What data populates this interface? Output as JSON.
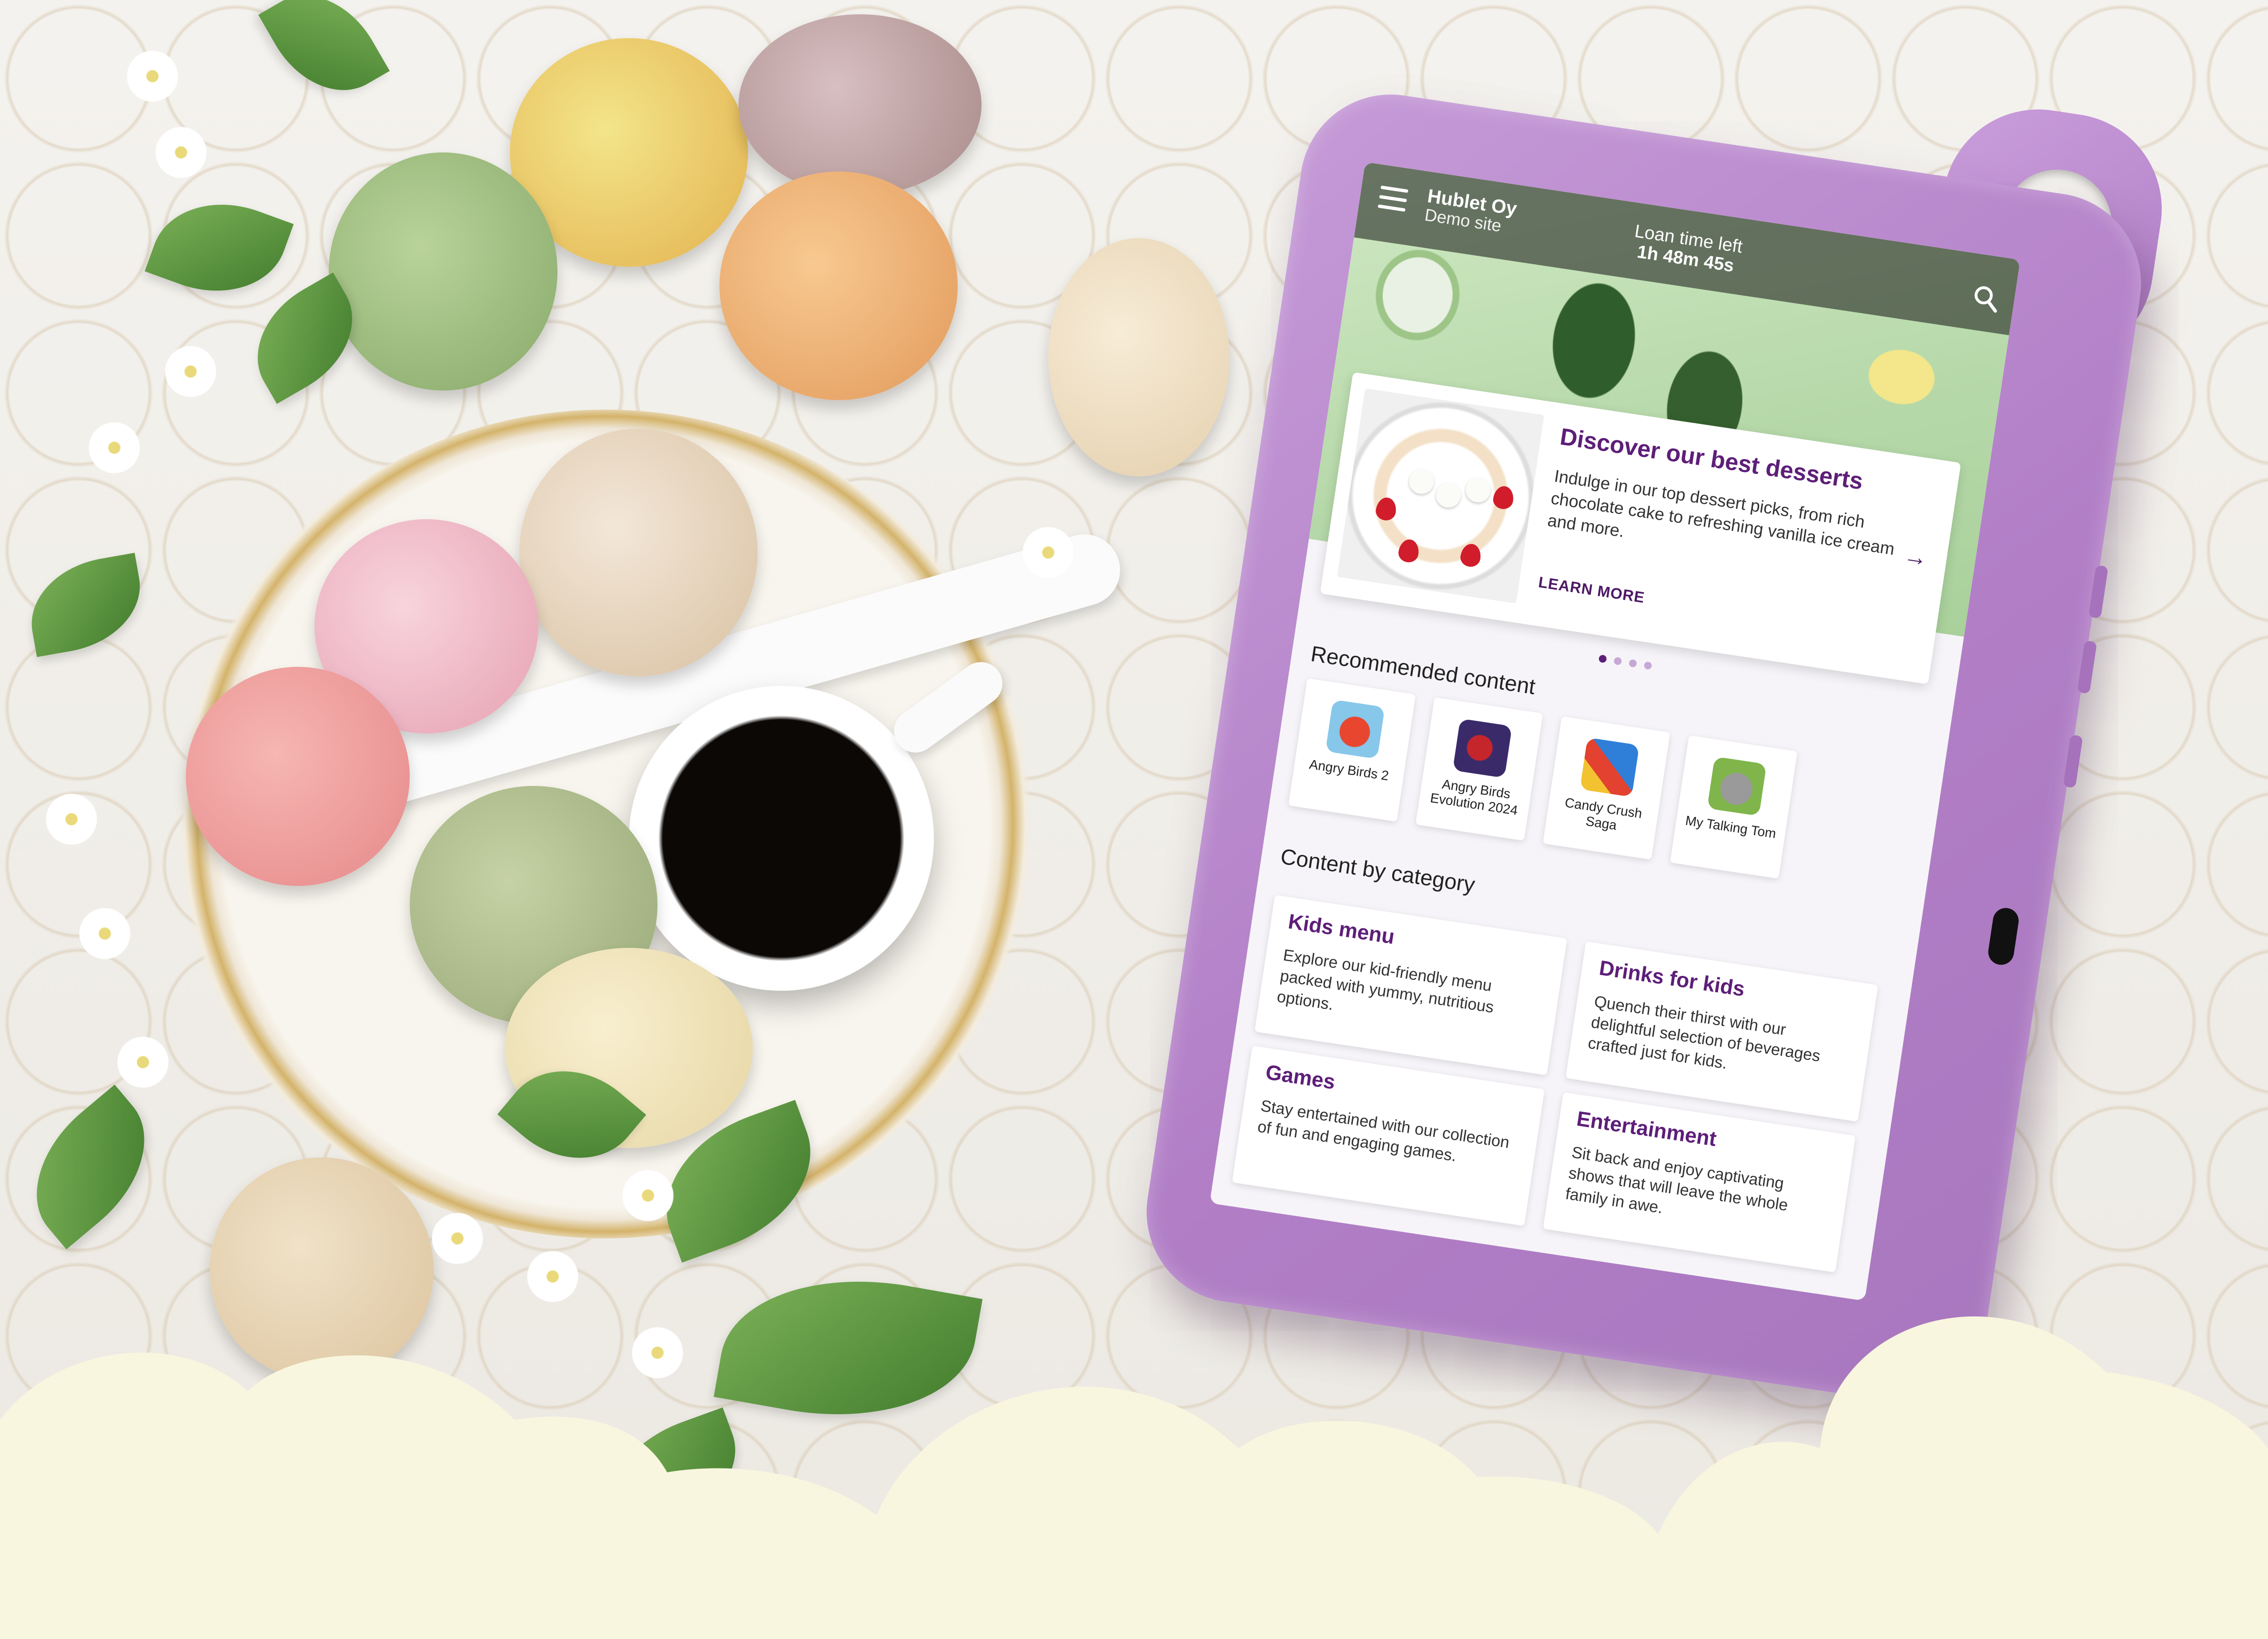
{
  "topbar": {
    "org_name": "Hublet Oy",
    "site_name": "Demo site",
    "loan_label": "Loan time left",
    "loan_value": "1h 48m 45s"
  },
  "featured": {
    "title": "Discover our best desserts",
    "description": "Indulge in our top dessert picks, from rich chocolate cake to refreshing vanilla ice cream and more.",
    "link_label": "LEARN MORE",
    "arrow": "→"
  },
  "carousel": {
    "count": 4,
    "active_index": 0
  },
  "recommended": {
    "title": "Recommended content",
    "apps": [
      {
        "name": "Angry Birds 2",
        "icon": "angry-birds-2-icon",
        "color": "#d23a2b"
      },
      {
        "name": "Angry Birds Evolution 2024",
        "icon": "angry-birds-evolution-icon",
        "color": "#3a2a6a"
      },
      {
        "name": "Candy Crush Saga",
        "icon": "candy-crush-icon",
        "color": "#2f7fd9"
      },
      {
        "name": "My Talking Tom",
        "icon": "talking-tom-icon",
        "color": "#7fb54a"
      }
    ]
  },
  "categories": {
    "title": "Content by category",
    "items": [
      {
        "title": "Kids menu",
        "description": "Explore our kid-friendly menu packed with yummy, nutritious options."
      },
      {
        "title": "Drinks for kids",
        "description": "Quench their thirst with our delightful selection of beverages crafted just for kids."
      },
      {
        "title": "Games",
        "description": "Stay entertained with our collection of fun and engaging games."
      },
      {
        "title": "Entertainment",
        "description": "Sit back and enjoy captivating shows that will leave the whole family in awe."
      }
    ]
  },
  "colors": {
    "accent": "#5d1e78",
    "case": "#b27fc7",
    "cloud": "#f8f6de"
  },
  "icons": {
    "menu": "hamburger-menu-icon",
    "search": "search-icon"
  }
}
